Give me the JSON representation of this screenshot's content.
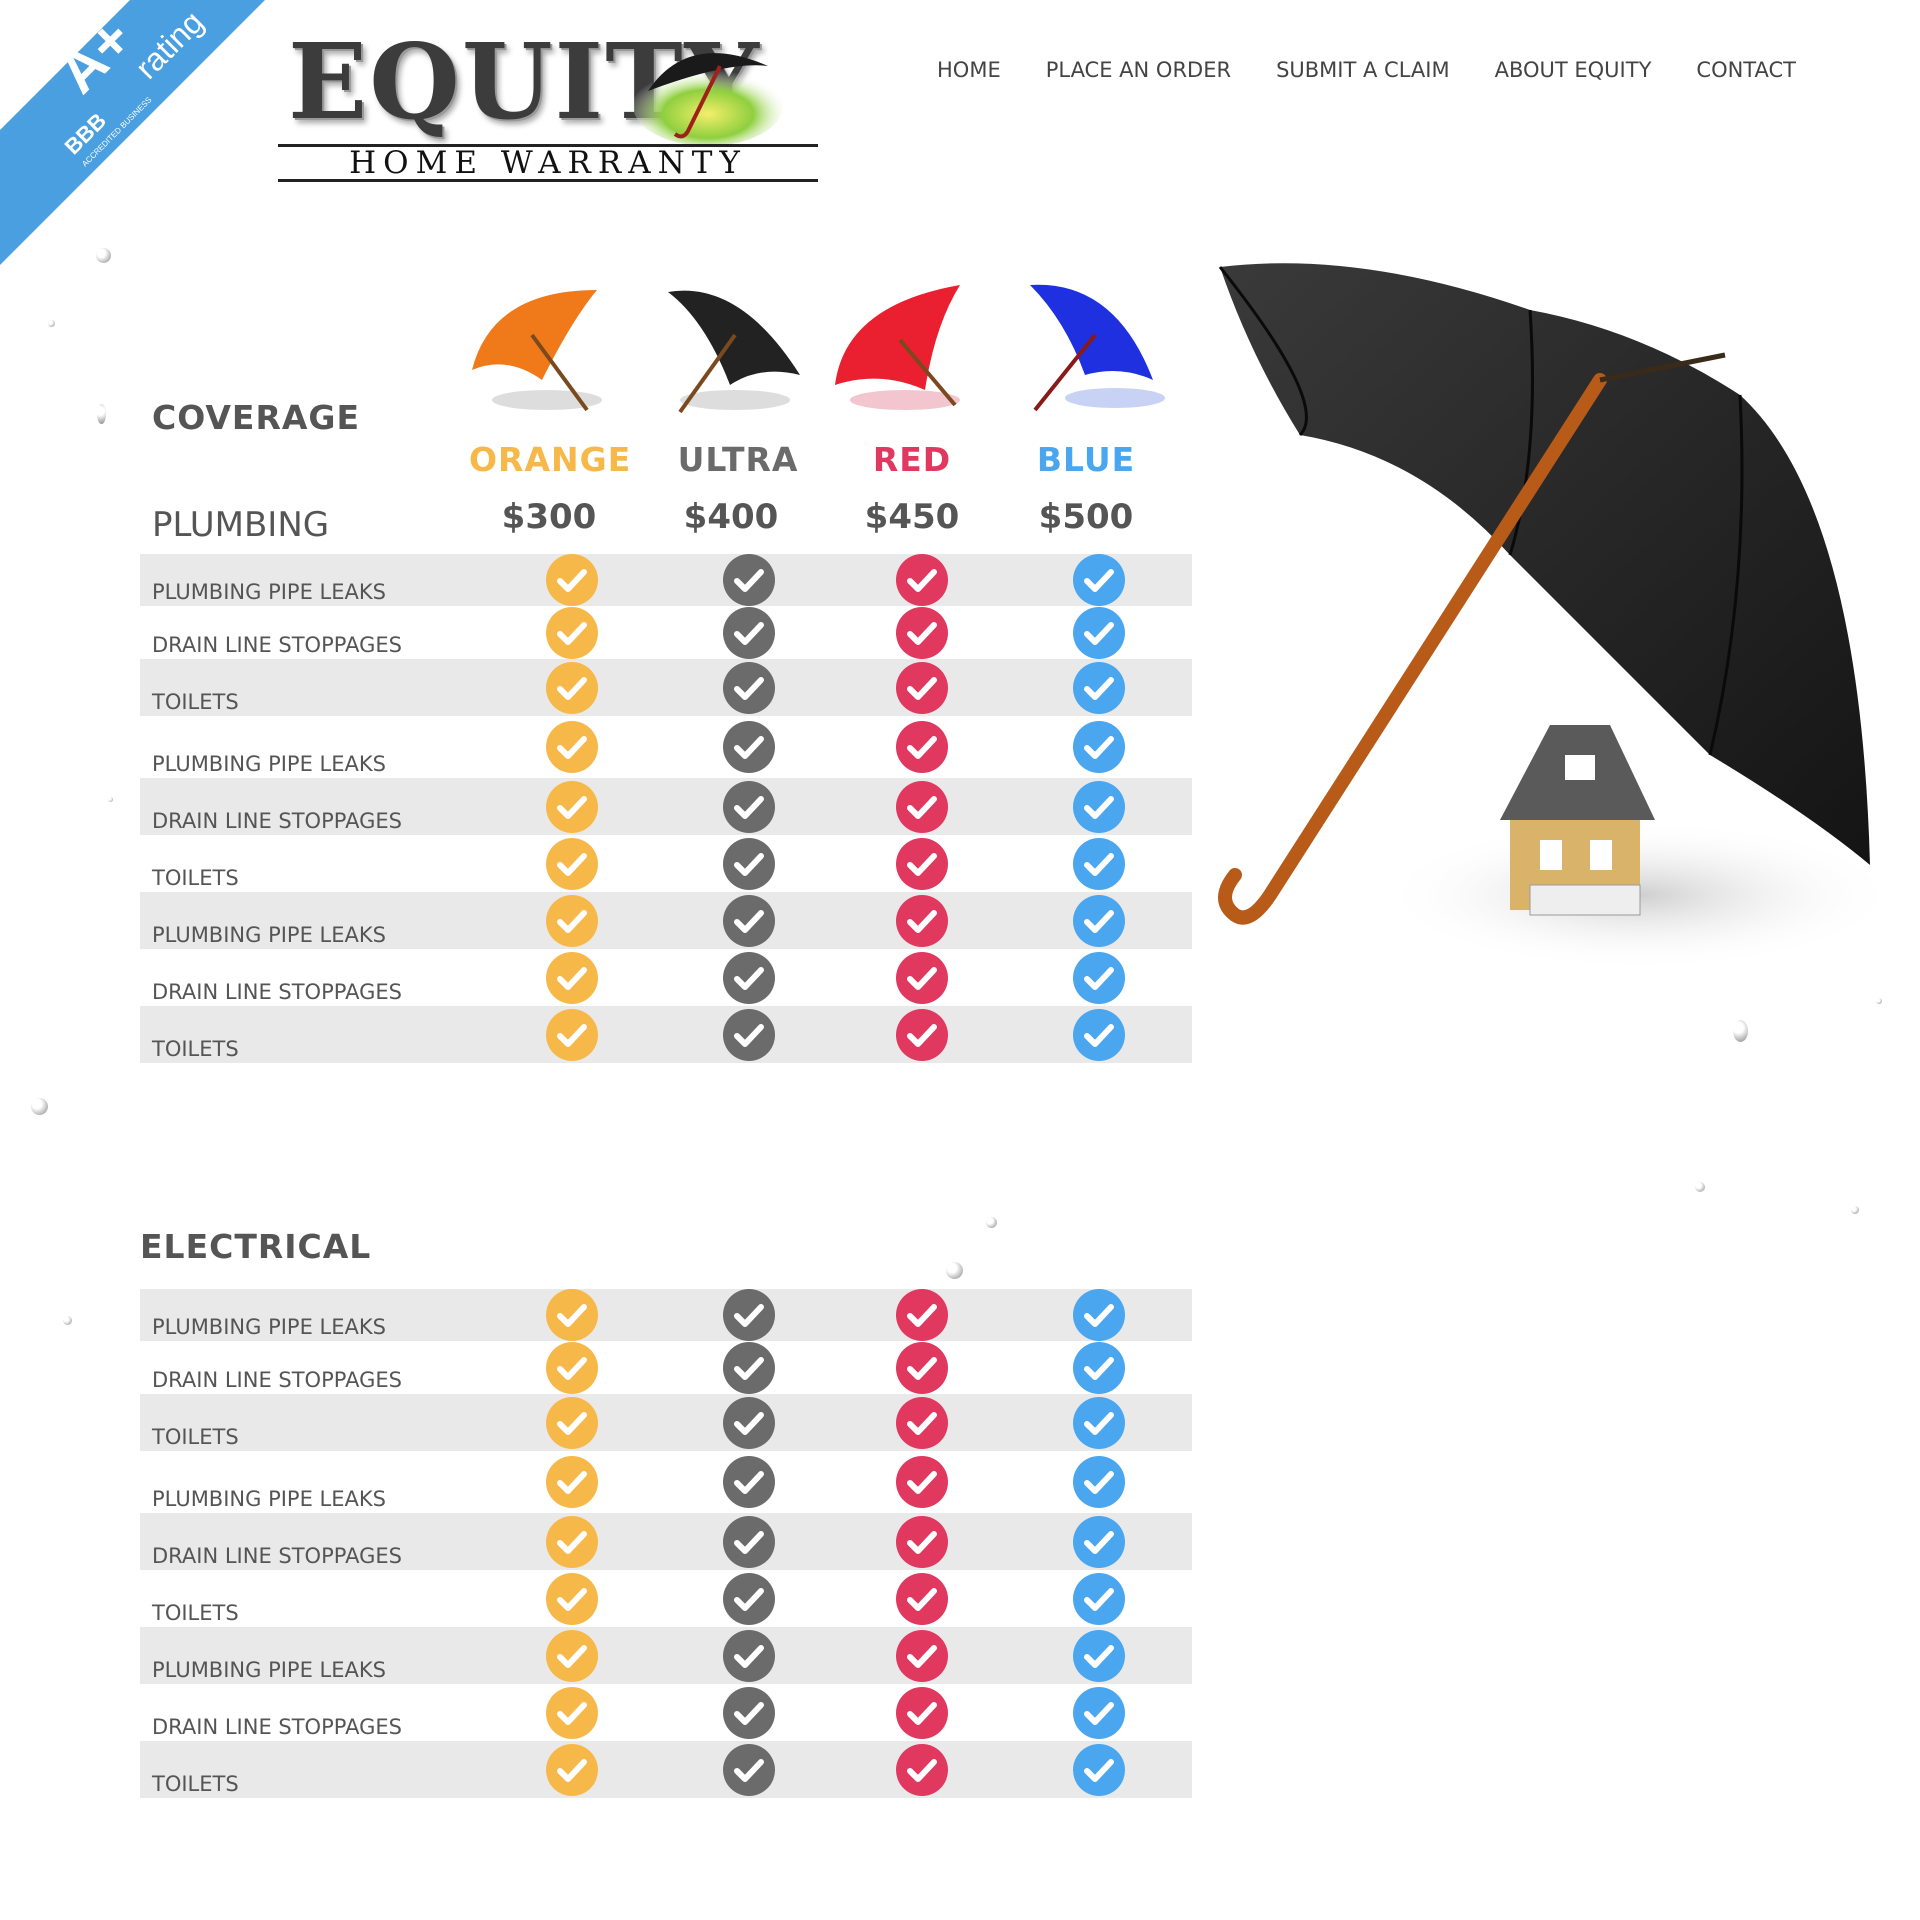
{
  "badge": {
    "grade": "A+",
    "rating": "rating",
    "org": "BBB",
    "sub": "ACCREDITED BUSINESS"
  },
  "logo": {
    "word": "EQUITY",
    "subtitle": "HOME WARRANTY"
  },
  "nav": [
    {
      "label": "HOME"
    },
    {
      "label": "PLACE AN ORDER"
    },
    {
      "label": "SUBMIT A CLAIM"
    },
    {
      "label": "ABOUT EQUITY"
    },
    {
      "label": "CONTACT"
    }
  ],
  "coverage": {
    "title": "COVERAGE",
    "subtitle": "PLUMBING",
    "plans": [
      {
        "name": "ORANGE",
        "price": "$300",
        "color": "#f7b84a"
      },
      {
        "name": "ULTRA",
        "price": "$400",
        "color": "#6b6b6b"
      },
      {
        "name": "RED",
        "price": "$450",
        "color": "#e0385e"
      },
      {
        "name": "BLUE",
        "price": "$500",
        "color": "#4aa6ef"
      }
    ]
  },
  "sections": [
    {
      "title": "",
      "rows": [
        {
          "label": "PLUMBING PIPE LEAKS"
        },
        {
          "label": "DRAIN LINE STOPPAGES"
        },
        {
          "label": "TOILETS"
        },
        {
          "label": "PLUMBING PIPE LEAKS"
        },
        {
          "label": "DRAIN LINE STOPPAGES"
        },
        {
          "label": "TOILETS"
        },
        {
          "label": "PLUMBING PIPE LEAKS"
        },
        {
          "label": "DRAIN LINE STOPPAGES"
        },
        {
          "label": "TOILETS"
        }
      ]
    },
    {
      "title": "ELECTRICAL",
      "rows": [
        {
          "label": "PLUMBING PIPE LEAKS"
        },
        {
          "label": "DRAIN LINE STOPPAGES"
        },
        {
          "label": "TOILETS"
        },
        {
          "label": "PLUMBING PIPE LEAKS"
        },
        {
          "label": "DRAIN LINE STOPPAGES"
        },
        {
          "label": "TOILETS"
        },
        {
          "label": "PLUMBING PIPE LEAKS"
        },
        {
          "label": "DRAIN LINE STOPPAGES"
        },
        {
          "label": "TOILETS"
        }
      ]
    }
  ],
  "colors": {
    "accent_orange": "#f7b84a",
    "accent_gray": "#6b6b6b",
    "accent_red": "#e0385e",
    "accent_blue": "#4aa6ef",
    "badge_blue": "#4a9fe0",
    "row_shade": "#e9e9e9"
  }
}
